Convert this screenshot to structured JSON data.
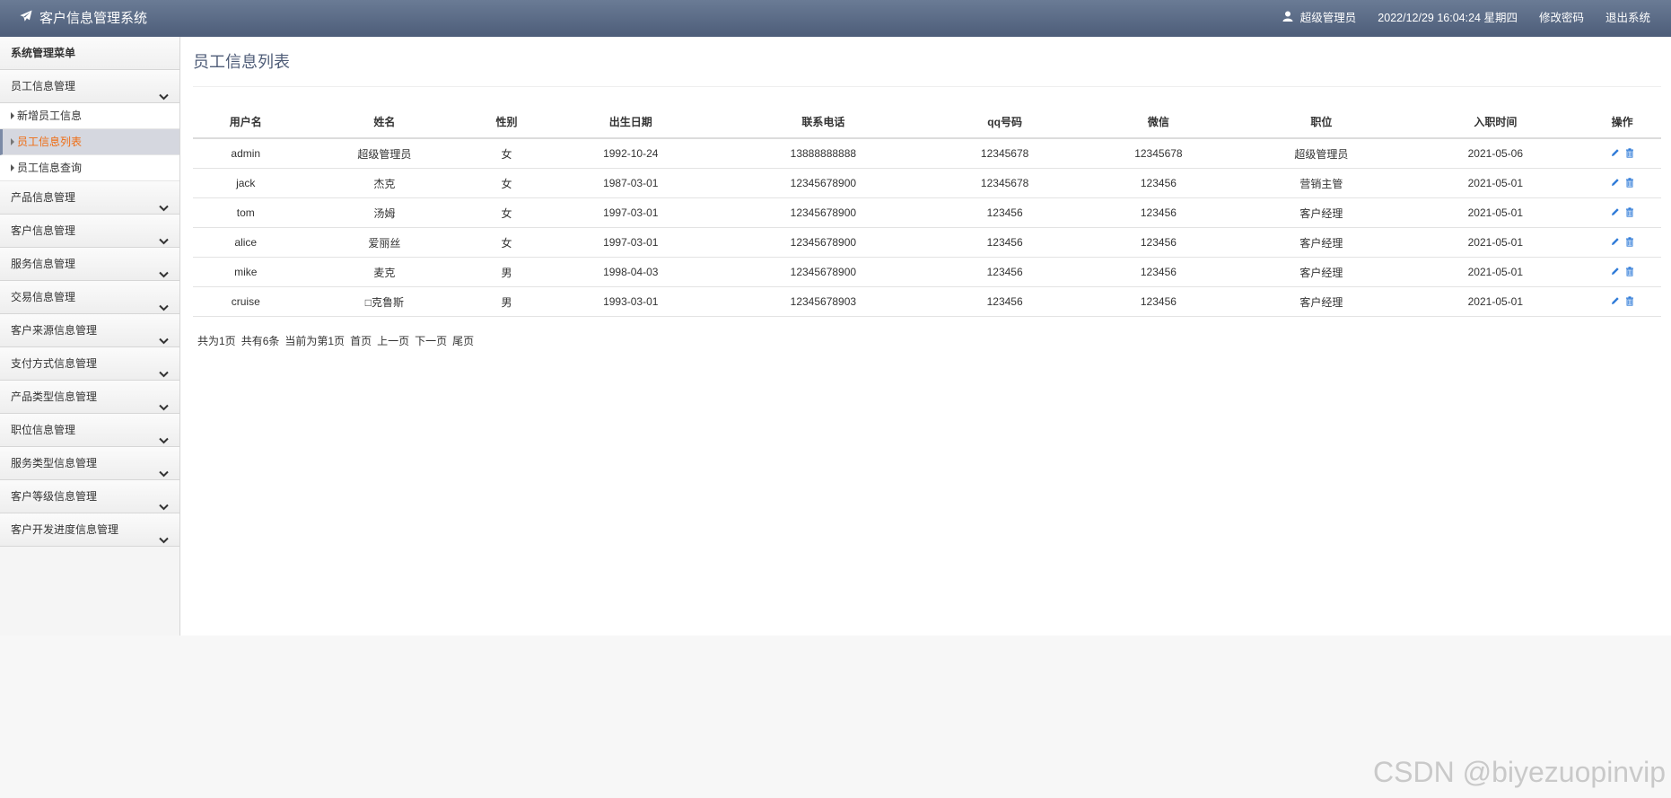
{
  "header": {
    "brand": "客户信息管理系统",
    "user": "超级管理员",
    "datetime": "2022/12/29 16:04:24 星期四",
    "change_password": "修改密码",
    "logout": "退出系统"
  },
  "sidebar": {
    "title": "系统管理菜单",
    "groups": [
      {
        "label": "员工信息管理",
        "expanded": true,
        "items": [
          {
            "label": "新增员工信息"
          },
          {
            "label": "员工信息列表",
            "active": true
          },
          {
            "label": "员工信息查询"
          }
        ]
      },
      {
        "label": "产品信息管理"
      },
      {
        "label": "客户信息管理"
      },
      {
        "label": "服务信息管理"
      },
      {
        "label": "交易信息管理"
      },
      {
        "label": "客户来源信息管理"
      },
      {
        "label": "支付方式信息管理"
      },
      {
        "label": "产品类型信息管理"
      },
      {
        "label": "职位信息管理"
      },
      {
        "label": "服务类型信息管理"
      },
      {
        "label": "客户等级信息管理"
      },
      {
        "label": "客户开发进度信息管理"
      }
    ]
  },
  "main": {
    "title": "员工信息列表",
    "table": {
      "headers": [
        "用户名",
        "姓名",
        "性别",
        "出生日期",
        "联系电话",
        "qq号码",
        "微信",
        "职位",
        "入职时间",
        "操作"
      ],
      "rows": [
        [
          "admin",
          "超级管理员",
          "女",
          "1992-10-24",
          "13888888888",
          "12345678",
          "12345678",
          "超级管理员",
          "2021-05-06"
        ],
        [
          "jack",
          "杰克",
          "女",
          "1987-03-01",
          "12345678900",
          "12345678",
          "123456",
          "营销主管",
          "2021-05-01"
        ],
        [
          "tom",
          "汤姆",
          "女",
          "1997-03-01",
          "12345678900",
          "123456",
          "123456",
          "客户经理",
          "2021-05-01"
        ],
        [
          "alice",
          "爱丽丝",
          "女",
          "1997-03-01",
          "12345678900",
          "123456",
          "123456",
          "客户经理",
          "2021-05-01"
        ],
        [
          "mike",
          "麦克",
          "男",
          "1998-04-03",
          "12345678900",
          "123456",
          "123456",
          "客户经理",
          "2021-05-01"
        ],
        [
          "cruise",
          "□克鲁斯",
          "男",
          "1993-03-01",
          "12345678903",
          "123456",
          "123456",
          "客户经理",
          "2021-05-01"
        ]
      ]
    },
    "pager": {
      "total_pages": "共为1页",
      "total_items": "共有6条",
      "current": "当前为第1页",
      "first": "首页",
      "prev": "上一页",
      "next": "下一页",
      "last": "尾页"
    }
  },
  "watermark": "CSDN @biyezuopinvip",
  "colors": {
    "header": "#5a6a86",
    "active_text": "#ef6c12",
    "icon": "#2f7bd8"
  },
  "icons": {
    "brand": "paper-plane-icon",
    "user": "user-icon",
    "chevron": "chevron-down-icon",
    "edit": "pencil-icon",
    "delete": "trash-icon"
  }
}
